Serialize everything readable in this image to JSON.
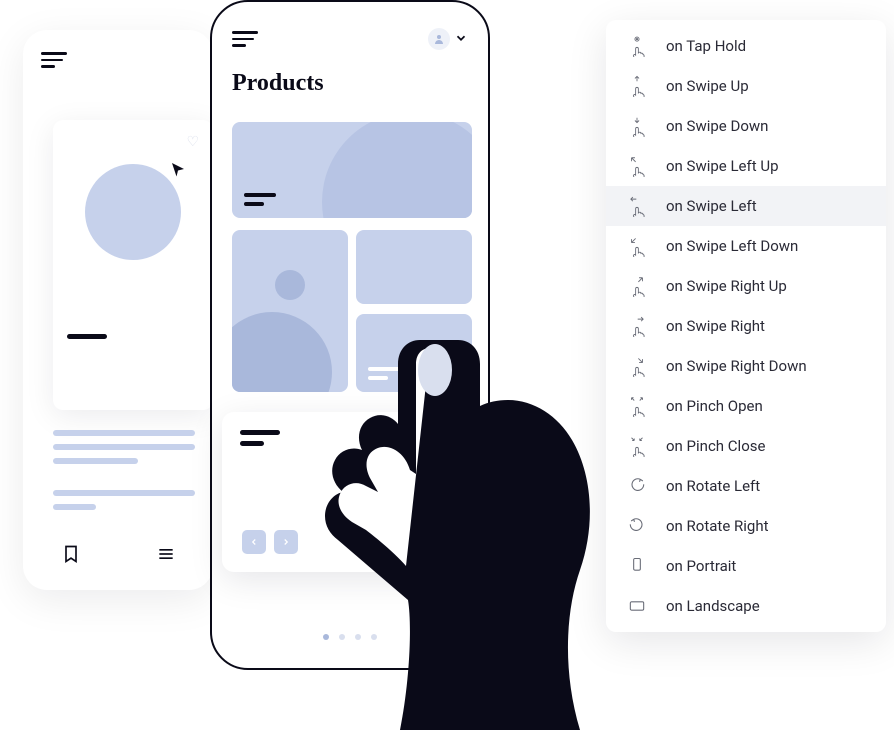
{
  "front_phone": {
    "title": "Products"
  },
  "menu": {
    "items": [
      {
        "icon": "tap-hold",
        "label": "on Tap Hold"
      },
      {
        "icon": "swipe-up",
        "label": "on Swipe Up"
      },
      {
        "icon": "swipe-down",
        "label": "on Swipe Down"
      },
      {
        "icon": "swipe-left-up",
        "label": "on Swipe Left Up"
      },
      {
        "icon": "swipe-left",
        "label": "on Swipe Left",
        "selected": true
      },
      {
        "icon": "swipe-left-down",
        "label": "on Swipe Left Down"
      },
      {
        "icon": "swipe-right-up",
        "label": "on Swipe Right Up"
      },
      {
        "icon": "swipe-right",
        "label": "on Swipe Right"
      },
      {
        "icon": "swipe-right-down",
        "label": "on Swipe Right Down"
      },
      {
        "icon": "pinch-open",
        "label": "on Pinch Open"
      },
      {
        "icon": "pinch-close",
        "label": "on Pinch Close"
      },
      {
        "icon": "rotate-left",
        "label": "on Rotate Left"
      },
      {
        "icon": "rotate-right",
        "label": "on Rotate Right"
      },
      {
        "icon": "portrait",
        "label": "on Portrait"
      },
      {
        "icon": "landscape",
        "label": "on Landscape"
      }
    ]
  }
}
